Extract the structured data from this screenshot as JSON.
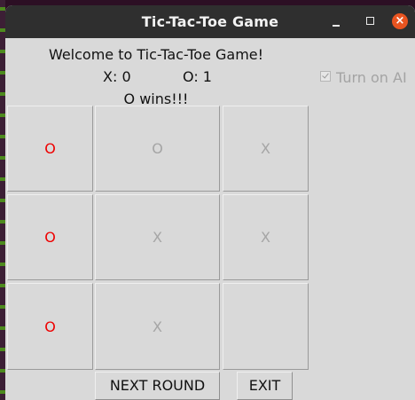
{
  "window": {
    "title": "Tic-Tac-Toe Game"
  },
  "header": {
    "welcome": "Welcome to Tic-Tac-Toe Game!",
    "score_x": "X: 0",
    "score_o": "O: 1",
    "result": "O wins!!!"
  },
  "ai_toggle": {
    "label": "Turn on AI",
    "checked": true
  },
  "board": {
    "cells": [
      [
        "O",
        "O",
        "X"
      ],
      [
        "O",
        "X",
        "X"
      ],
      [
        "O",
        "X",
        ""
      ]
    ],
    "winning_line": "left column"
  },
  "buttons": {
    "next_round": "NEXT ROUND",
    "exit": "EXIT"
  },
  "icons": {
    "minimize": "minimize-icon",
    "maximize": "maximize-icon",
    "close": "close-icon"
  },
  "colors": {
    "winning_mark": "#ee0000",
    "normal_mark": "#a5a5a5",
    "close_button": "#e95420"
  }
}
